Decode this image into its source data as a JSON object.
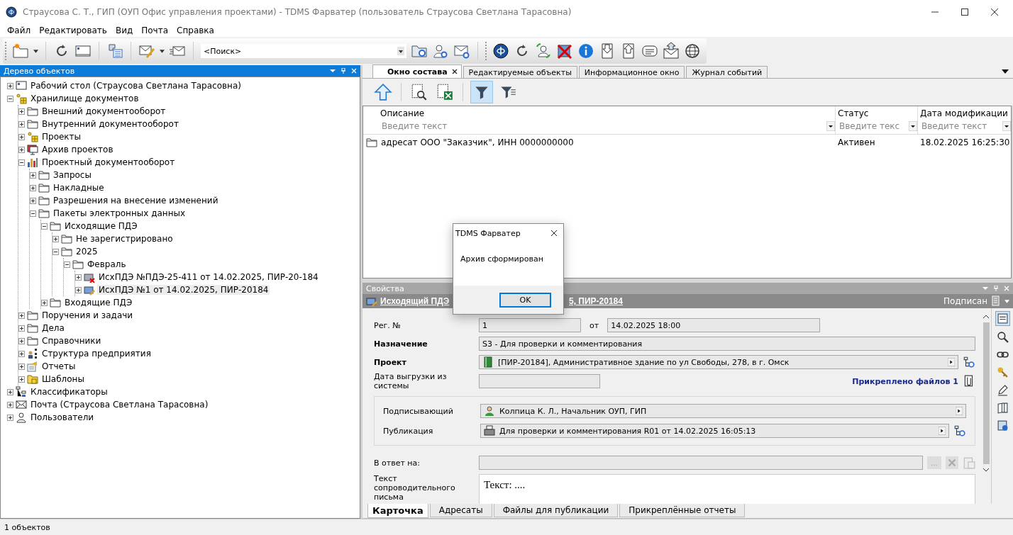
{
  "window": {
    "title": "Страусова С. Т., ГИП (ОУП Офис управления проектами) - TDMS Фарватер (пользователь Страусова Светлана Тарасовна)"
  },
  "menu": [
    "Файл",
    "Редактировать",
    "Вид",
    "Почта",
    "Справка"
  ],
  "toolbar": {
    "search": {
      "placeholder": "<Поиск>"
    }
  },
  "tree_panel": {
    "title": "Дерево объектов",
    "nodes": [
      {
        "label": "Рабочий стол (Страусова Светлана Тарасовна)",
        "kind": "desktop",
        "expanded": false,
        "selected": false
      },
      {
        "label": "Хранилище документов",
        "kind": "storage",
        "expanded": true,
        "selected": false,
        "children": [
          {
            "label": "Внешний документооборот",
            "kind": "folder",
            "expanded": false,
            "selected": false
          },
          {
            "label": "Внутренний документооборот",
            "kind": "folder",
            "expanded": false,
            "selected": false
          },
          {
            "label": "Проекты",
            "kind": "storage",
            "expanded": false,
            "selected": false
          },
          {
            "label": "Архив проектов",
            "kind": "archive",
            "expanded": false,
            "selected": false
          },
          {
            "label": "Проектный документооборот",
            "kind": "chart",
            "expanded": true,
            "selected": false,
            "children": [
              {
                "label": "Запросы",
                "kind": "folder",
                "expanded": false,
                "selected": false
              },
              {
                "label": "Накладные",
                "kind": "folder",
                "expanded": false,
                "selected": false
              },
              {
                "label": "Разрешения на внесение изменений",
                "kind": "folder",
                "expanded": false,
                "selected": false
              },
              {
                "label": "Пакеты электронных данных",
                "kind": "folder",
                "expanded": true,
                "selected": false,
                "children": [
                  {
                    "label": "Исходящие ПДЭ",
                    "kind": "folder",
                    "expanded": true,
                    "selected": false,
                    "children": [
                      {
                        "label": "Не зарегистрировано",
                        "kind": "folder",
                        "expanded": false,
                        "selected": false
                      },
                      {
                        "label": "2025",
                        "kind": "folder",
                        "expanded": true,
                        "selected": false,
                        "children": [
                          {
                            "label": "Февраль",
                            "kind": "folder",
                            "expanded": true,
                            "selected": false,
                            "children": [
                              {
                                "label": "ИсхПДЭ №ПДЭ-25-411 от 14.02.2025, ПИР-20-184",
                                "kind": "package-cancelled",
                                "expanded": false,
                                "selected": false
                              },
                              {
                                "label": "ИсхПДЭ №1 от 14.02.2025, ПИР-20184",
                                "kind": "package-edit",
                                "expanded": false,
                                "selected": true
                              }
                            ]
                          }
                        ]
                      }
                    ]
                  },
                  {
                    "label": "Входящие ПДЭ",
                    "kind": "folder",
                    "expanded": false,
                    "selected": false
                  }
                ]
              }
            ]
          },
          {
            "label": "Поручения и задачи",
            "kind": "folder",
            "expanded": false,
            "selected": false
          },
          {
            "label": "Дела",
            "kind": "folder",
            "expanded": false,
            "selected": false
          },
          {
            "label": "Справочники",
            "kind": "folder",
            "expanded": false,
            "selected": false
          },
          {
            "label": "Структура предприятия",
            "kind": "org",
            "expanded": false,
            "selected": false
          },
          {
            "label": "Отчеты",
            "kind": "reports",
            "expanded": false,
            "selected": false
          },
          {
            "label": "Шаблоны",
            "kind": "templates",
            "expanded": false,
            "selected": false
          }
        ]
      },
      {
        "label": "Классификаторы",
        "kind": "classifier",
        "expanded": false,
        "selected": false
      },
      {
        "label": "Почта (Страусова Светлана Тарасовна)",
        "kind": "mail",
        "expanded": false,
        "selected": false
      },
      {
        "label": "Пользователи",
        "kind": "users",
        "expanded": false,
        "selected": false
      }
    ]
  },
  "tabs": [
    {
      "label": "Окно состава",
      "selected": true,
      "closable": true
    },
    {
      "label": "Редактируемые объекты",
      "selected": false,
      "closable": false
    },
    {
      "label": "Информационное окно",
      "selected": false,
      "closable": false
    },
    {
      "label": "Журнал событий",
      "selected": false,
      "closable": false
    }
  ],
  "table": {
    "filter_on": true,
    "columns": [
      {
        "label": "Описание",
        "placeholder": "Введите текст"
      },
      {
        "label": "Статус",
        "placeholder": "Введите текс"
      },
      {
        "label": "Дата модификации",
        "placeholder": "Введите текст"
      }
    ],
    "rows": [
      {
        "cells": [
          "адресат ООО \"Заказчик\", ИНН 0000000000",
          "Активен",
          "18.02.2025 16:25:30"
        ]
      }
    ]
  },
  "properties": {
    "title": "Свойства",
    "object_title_start": "Исходящий ПДЭ",
    "object_title_end": "5, ПИР-20184",
    "status": "Подписан",
    "reg": {
      "label": "Рег. №",
      "value": "1",
      "date_label": "от",
      "date_value": "14.02.2025 18:00"
    },
    "rows": [
      {
        "kind": "text",
        "label": "Назначение",
        "required": true,
        "value": "S3 - Для проверки и комментирования"
      },
      {
        "kind": "ref",
        "label": "Проект",
        "required": true,
        "value": "[ПИР-20184], Административное здание по ул Свободы, 278, в г. Омск",
        "lookup": true
      },
      {
        "kind": "attach",
        "label": "Дата выгрузки из системы",
        "required": false,
        "link": "Прикреплено файлов 1"
      }
    ],
    "group": [
      {
        "kind": "ref",
        "label": "Подписывающий",
        "required": false,
        "value": "Колпица К. Л., Начальник ОУП, ГИП",
        "lookup": false
      },
      {
        "kind": "ref",
        "label": "Публикация",
        "required": false,
        "value": "Для проверки и комментирования R01 от 14.02.2025 16:05:13",
        "lookup": true
      }
    ],
    "reply": {
      "label": "В ответ на:",
      "browse": "..."
    },
    "letter": {
      "label": "Текст сопроводительного письма",
      "value": "Текст: ...."
    },
    "tabs": [
      {
        "label": "Карточка",
        "selected": true
      },
      {
        "label": "Адресаты",
        "selected": false
      },
      {
        "label": "Файлы для публикации",
        "selected": false
      },
      {
        "label": "Прикреплённые отчеты",
        "selected": false
      }
    ]
  },
  "dialog": {
    "title": "TDMS Фарватер",
    "message": "Архив сформирован",
    "button": "OK"
  },
  "status_bar": {
    "text": "1 объектов"
  }
}
